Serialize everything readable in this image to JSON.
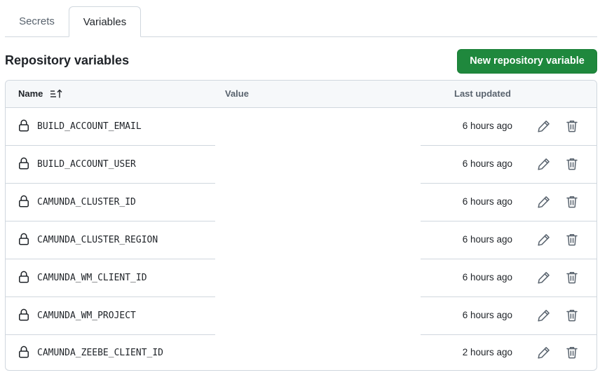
{
  "tabs": [
    {
      "label": "Secrets",
      "active": false
    },
    {
      "label": "Variables",
      "active": true
    }
  ],
  "section": {
    "title": "Repository variables",
    "new_button_label": "New repository variable"
  },
  "table": {
    "headers": {
      "name": "Name",
      "value": "Value",
      "last_updated": "Last updated"
    },
    "rows": [
      {
        "name": "BUILD_ACCOUNT_EMAIL",
        "updated": "6 hours ago"
      },
      {
        "name": "BUILD_ACCOUNT_USER",
        "updated": "6 hours ago"
      },
      {
        "name": "CAMUNDA_CLUSTER_ID",
        "updated": "6 hours ago"
      },
      {
        "name": "CAMUNDA_CLUSTER_REGION",
        "updated": "6 hours ago"
      },
      {
        "name": "CAMUNDA_WM_CLIENT_ID",
        "updated": "6 hours ago"
      },
      {
        "name": "CAMUNDA_WM_PROJECT",
        "updated": "6 hours ago"
      },
      {
        "name": "CAMUNDA_ZEEBE_CLIENT_ID",
        "updated": "2 hours ago"
      }
    ]
  },
  "icons": {
    "row_icon": "lock-icon",
    "edit": "pencil-icon",
    "delete": "trash-icon",
    "sort": "sort-ascending-icon"
  },
  "colors": {
    "primary_button": "#1f883d",
    "border": "#d0d7de",
    "header_bg": "#f6f8fa"
  }
}
